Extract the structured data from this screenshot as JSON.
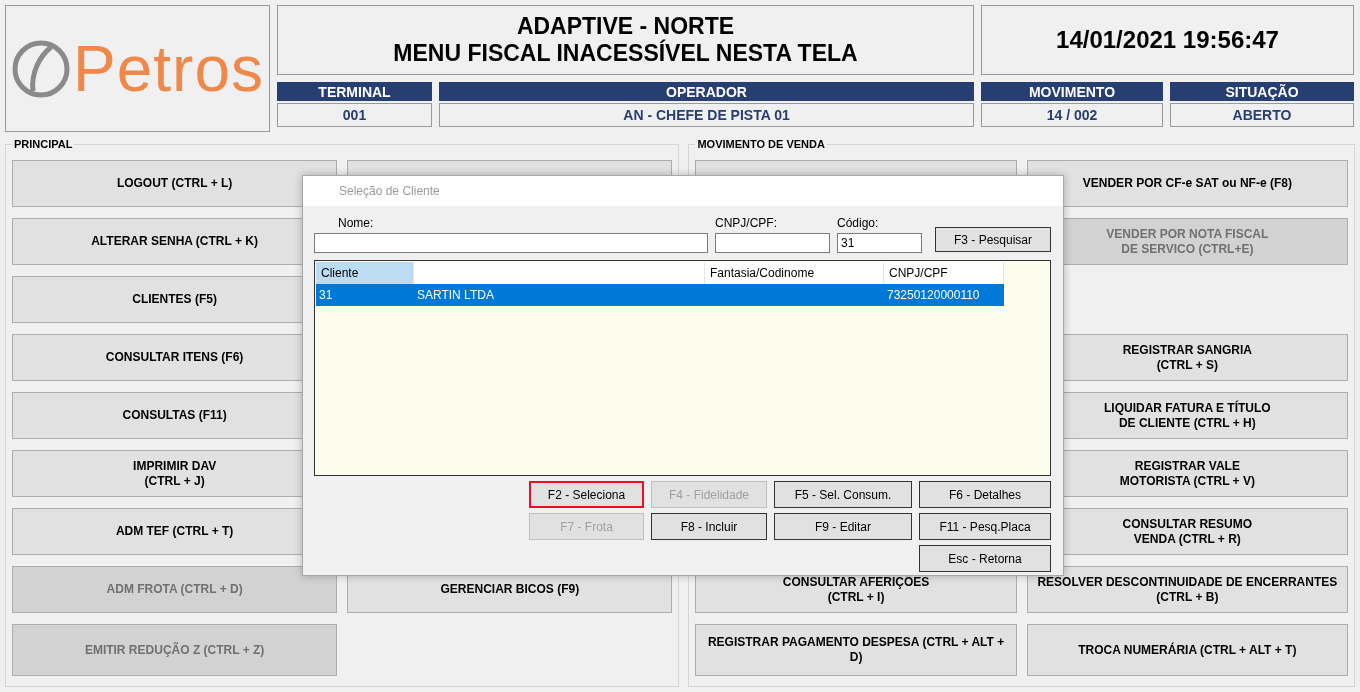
{
  "header": {
    "logo_text": "Petros",
    "title_lines": [
      "ADAPTIVE - NORTE",
      "MENU FISCAL INACESSÍVEL NESTA TELA"
    ],
    "datetime": "14/01/2021 19:56:47",
    "info": [
      {
        "label": "TERMINAL",
        "value": "001"
      },
      {
        "label": "OPERADOR",
        "value": "AN - CHEFE DE PISTA 01"
      },
      {
        "label": "MOVIMENTO",
        "value": "14 / 002"
      },
      {
        "label": "SITUAÇÃO",
        "value": "ABERTO"
      }
    ]
  },
  "groups": [
    {
      "title": "PRINCIPAL",
      "rows": [
        [
          {
            "kind": "button",
            "label": "LOGOUT (CTRL + L)",
            "disabled": false
          },
          {
            "kind": "blank"
          }
        ],
        [
          {
            "kind": "button",
            "label": "ALTERAR SENHA (CTRL + K)",
            "disabled": false
          },
          {
            "kind": "gap"
          }
        ],
        [
          {
            "kind": "button",
            "label": "CLIENTES (F5)",
            "disabled": false
          },
          {
            "kind": "gap"
          }
        ],
        [
          {
            "kind": "button",
            "label": "CONSULTAR ITENS (F6)",
            "disabled": false
          },
          {
            "kind": "gap"
          }
        ],
        [
          {
            "kind": "button",
            "label": "CONSULTAS (F11)",
            "disabled": false
          },
          {
            "kind": "gap"
          }
        ],
        [
          {
            "kind": "button",
            "label": "IMPRIMIR DAV\n(CTRL + J)",
            "disabled": false
          },
          {
            "kind": "gap"
          }
        ],
        [
          {
            "kind": "button",
            "label": "ADM TEF (CTRL + T)",
            "disabled": false
          },
          {
            "kind": "gap"
          }
        ],
        [
          {
            "kind": "button",
            "label": "ADM FROTA (CTRL + D)",
            "disabled": true
          },
          {
            "kind": "button",
            "label": "GERENCIAR BICOS (F9)",
            "disabled": false
          }
        ],
        [
          {
            "kind": "button",
            "label": "EMITIR REDUÇÃO Z (CTRL + Z)",
            "disabled": true
          },
          {
            "kind": "gap"
          }
        ]
      ]
    },
    {
      "title": "MOVIMENTO DE VENDA",
      "rows": [
        [
          {
            "kind": "blank"
          },
          {
            "kind": "button",
            "label": "VENDER POR CF-e SAT ou NF-e (F8)",
            "disabled": false
          }
        ],
        [
          {
            "kind": "gap"
          },
          {
            "kind": "button",
            "label": "VENDER POR NOTA FISCAL\nDE SERVICO (CTRL+E)",
            "disabled": true
          }
        ],
        [
          {
            "kind": "gap"
          },
          {
            "kind": "gap"
          }
        ],
        [
          {
            "kind": "gap"
          },
          {
            "kind": "button",
            "label": "REGISTRAR SANGRIA\n(CTRL + S)",
            "disabled": false
          }
        ],
        [
          {
            "kind": "gap"
          },
          {
            "kind": "button",
            "label": "LIQUIDAR FATURA E TÍTULO\nDE CLIENTE (CTRL + H)",
            "disabled": false
          }
        ],
        [
          {
            "kind": "gap"
          },
          {
            "kind": "button",
            "label": "REGISTRAR VALE\nMOTORISTA (CTRL + V)",
            "disabled": false
          }
        ],
        [
          {
            "kind": "gap"
          },
          {
            "kind": "button",
            "label": "CONSULTAR RESUMO\nVENDA (CTRL + R)",
            "disabled": false
          }
        ],
        [
          {
            "kind": "button",
            "label": "CONSULTAR AFERIÇÕES\n(CTRL + I)",
            "disabled": false
          },
          {
            "kind": "button",
            "label": "RESOLVER DESCONTINUIDADE DE ENCERRANTES\n(CTRL + B)",
            "disabled": false
          }
        ],
        [
          {
            "kind": "button",
            "label": "REGISTRAR PAGAMENTO DESPESA (CTRL + ALT +\nD)",
            "disabled": false
          },
          {
            "kind": "button",
            "label": "TROCA NUMERÁRIA (CTRL + ALT + T)",
            "disabled": false
          }
        ]
      ]
    }
  ],
  "dialog": {
    "title": "Seleção de Cliente",
    "fields": [
      {
        "label": "Nome:"
      },
      {
        "label": "CNPJ/CPF:"
      },
      {
        "label": "Código:",
        "value": "31"
      }
    ],
    "search_button": "F3 - Pesquisar",
    "table": {
      "columns": [
        {
          "label": "Cliente",
          "highlighted": true
        },
        {
          "highlighted": false
        },
        {
          "label": "Fantasia/Codinome",
          "highlighted": false
        },
        {
          "label": "CNPJ/CPF",
          "highlighted": false
        }
      ],
      "rows": [
        {
          "selected": true,
          "cells": [
            "31",
            "SARTIN LTDA",
            null,
            "73250120000110"
          ]
        }
      ]
    },
    "button_rows": [
      [
        {
          "label": "F2 - Seleciona",
          "disabled": false,
          "focused": true
        },
        {
          "label": "F4 - Fidelidade",
          "disabled": true,
          "focused": false
        },
        {
          "label": "F5 - Sel. Consum.",
          "disabled": false,
          "focused": false
        },
        {
          "label": "F6 - Detalhes",
          "disabled": false,
          "focused": false
        }
      ],
      [
        {
          "label": "F7 - Frota",
          "disabled": true,
          "focused": false
        },
        {
          "label": "F8 - Incluir",
          "disabled": false,
          "focused": false
        },
        {
          "label": "F9 - Editar",
          "disabled": false,
          "focused": false
        },
        {
          "label": "F11 - Pesq.Placa",
          "disabled": false,
          "focused": false
        }
      ],
      [
        {
          "label": "Esc - Retorna",
          "disabled": false,
          "focused": false
        }
      ]
    ]
  }
}
